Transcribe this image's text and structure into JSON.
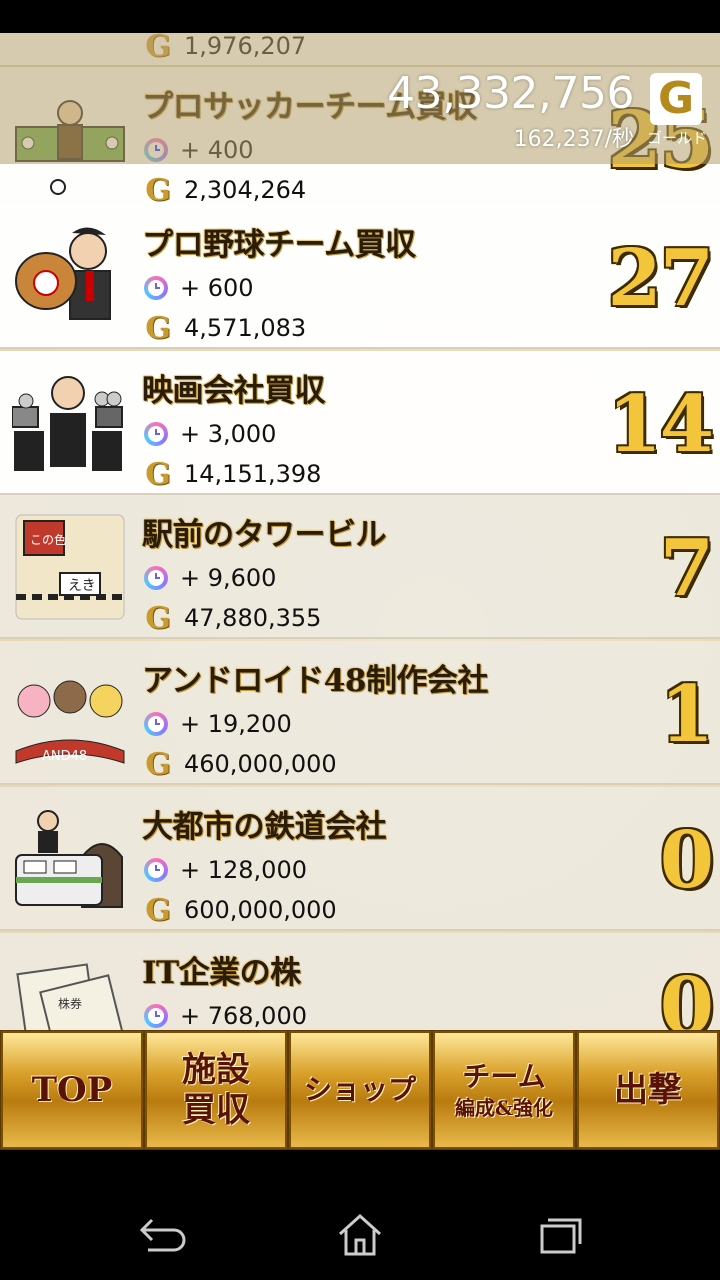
{
  "header": {
    "gold_total": "43,332,756",
    "gold_per_sec": "162,237/秒",
    "gold_badge": "G",
    "gold_badge_label": "ゴールド"
  },
  "facilities": [
    {
      "name": "",
      "rate": "",
      "cost": "1,976,207",
      "count": ""
    },
    {
      "name": "プロサッカーチーム買収",
      "rate": "+ 400",
      "cost": "2,304,264",
      "count": "25"
    },
    {
      "name": "プロ野球チーム買収",
      "rate": "+ 600",
      "cost": "4,571,083",
      "count": "27"
    },
    {
      "name": "映画会社買収",
      "rate": "+ 3,000",
      "cost": "14,151,398",
      "count": "14"
    },
    {
      "name": "駅前のタワービル",
      "rate": "+ 9,600",
      "cost": "47,880,355",
      "count": "7"
    },
    {
      "name": "アンドロイド48制作会社",
      "rate": "+ 19,200",
      "cost": "460,000,000",
      "count": "1"
    },
    {
      "name": "大都市の鉄道会社",
      "rate": "+ 128,000",
      "cost": "600,000,000",
      "count": "0"
    },
    {
      "name": "IT企業の株",
      "rate": "+ 768,000",
      "cost": "",
      "count": "0"
    }
  ],
  "thumb_text": {
    "station_sign": "この色",
    "station_label": "えき",
    "idol_banner": "AND48",
    "stock_label": "株券"
  },
  "nav": {
    "top": "TOP",
    "facility_line1": "施設",
    "facility_line2": "買収",
    "shop": "ショップ",
    "team_line1": "チーム",
    "team_line2": "編成&強化",
    "sortie": "出撃"
  },
  "colors": {
    "nav_gold": "#d9a12b",
    "count_gold": "#f3c53a",
    "text_dark": "#2a1c06"
  }
}
